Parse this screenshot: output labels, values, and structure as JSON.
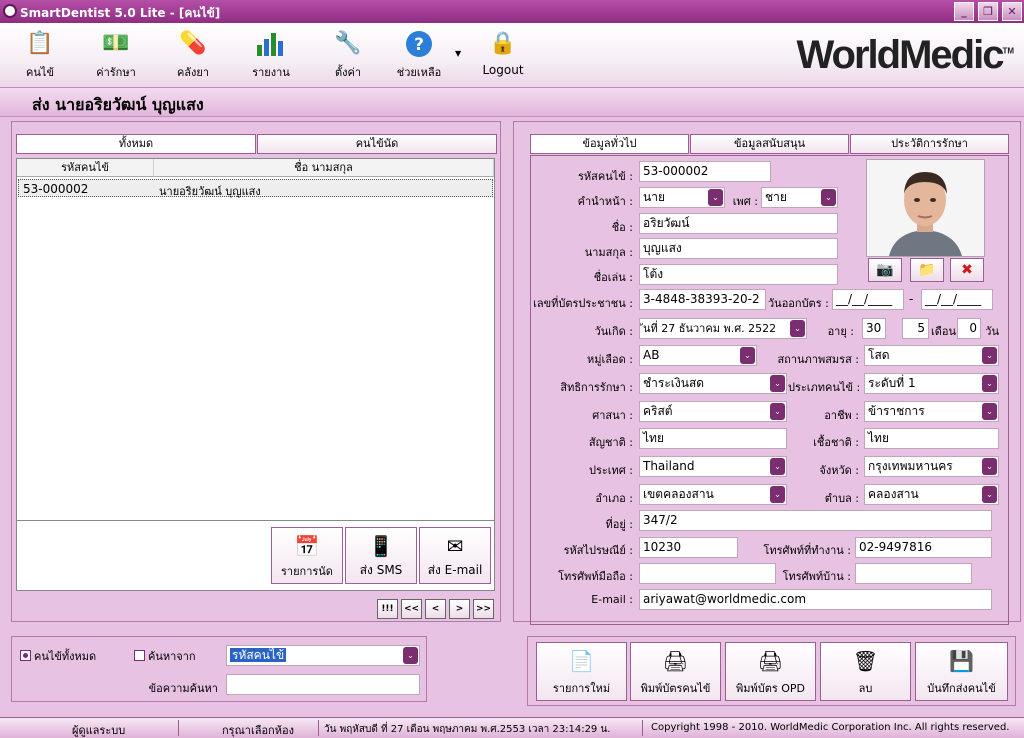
{
  "window": {
    "title": "SmartDentist 5.0 Lite - [คนไข้]"
  },
  "toolbar": {
    "items": [
      {
        "label": "คนไข้",
        "icon": "patient-icon"
      },
      {
        "label": "ค่ารักษา",
        "icon": "money-icon"
      },
      {
        "label": "คลังยา",
        "icon": "medicine-icon"
      },
      {
        "label": "รายงาน",
        "icon": "report-chart-icon"
      },
      {
        "label": "ตั้งค่า",
        "icon": "settings-tools-icon"
      },
      {
        "label": "ช่วยเหลือ",
        "icon": "help-icon"
      },
      {
        "label": "Logout",
        "icon": "lock-icon"
      }
    ],
    "brand": "WorldMedic",
    "brand_mark": "TM"
  },
  "patient_header": "ส่ง  นายอริยวัฒน์ บุญแสง",
  "left": {
    "tabs": [
      "ทั้งหมด",
      "คนไข้นัด"
    ],
    "columns": [
      "รหัสคนไข้",
      "ชื่อ นามสกุล"
    ],
    "rows": [
      {
        "id": "53-000002",
        "name": "นายอริยวัฒน์ บุญแสง"
      }
    ],
    "actions": {
      "appointments": "รายการนัด",
      "sms": "ส่ง SMS",
      "email": "ส่ง E-mail"
    },
    "nav": {
      "first": "!!!",
      "prev_page": "<<",
      "prev": "<",
      "next": ">",
      "next_page": ">>"
    },
    "search": {
      "radio_all": "คนไข้ทั้งหมด",
      "radio_search": "ค้นหาจาก",
      "search_by": "รหัสคนไข้",
      "keyword_label": "ข้อความค้นหา",
      "keyword": ""
    }
  },
  "right": {
    "tabs": [
      "ข้อมูลทั่วไป",
      "ข้อมูลสนับสนุน",
      "ประวัติการรักษา"
    ],
    "labels": {
      "patient_id": "รหัสคนไข้ :",
      "prefix": "คำนำหน้า :",
      "sex": "เพศ :",
      "first_name": "ชื่อ :",
      "last_name": "นามสกุล :",
      "nickname": "ชื่อเล่น :",
      "id_card": "เลขที่บัตรประชาชน :",
      "card_issue": "วันออกบัตร :",
      "birth": "วันเกิด :",
      "age": "อายุ :",
      "month": "เดือน",
      "day": "วัน",
      "blood": "หมู่เลือด :",
      "marital": "สถานภาพสมรส :",
      "right_to_treat": "สิทธิการรักษา :",
      "patient_type": "ประเภทคนไข้ :",
      "religion": "ศาสนา :",
      "career": "อาชีพ :",
      "nationality": "สัญชาติ :",
      "race": "เชื้อชาติ :",
      "country": "ประเทศ :",
      "province": "จังหวัด :",
      "district": "อำเภอ :",
      "subdistrict": "ตำบล :",
      "address": "ที่อยู่ :",
      "postcode": "รหัสไปรษณีย์ :",
      "work_phone": "โทรศัพท์ที่ทำงาน :",
      "mobile": "โทรศัพท์มือถือ :",
      "home_phone": "โทรศัพท์บ้าน :",
      "email": "E-mail :"
    },
    "values": {
      "patient_id": "53-000002",
      "prefix": "นาย",
      "sex": "ชาย",
      "first_name": "อริยวัฒน์",
      "last_name": "บุญแสง",
      "nickname": "โต้ง",
      "id_card": "3-4848-38393-20-2",
      "card_issue_from": "__/__/____",
      "card_issue_dash": "-",
      "card_issue_to": "__/__/____",
      "birth": "ันที่ 27  ธันวาคม  พ.ศ.  2522",
      "age_years": "30",
      "age_months": "5",
      "age_days": "0",
      "blood": "AB",
      "marital": "โสด",
      "right_to_treat": "ชำระเงินสด",
      "patient_type": "ระดับที่ 1",
      "religion": "คริสต์",
      "career": "ข้าราชการ",
      "nationality": "ไทย",
      "race": "ไทย",
      "country": "Thailand",
      "province": "กรุงเทพมหานคร",
      "district": "เขตคลองสาน",
      "subdistrict": "คลองสาน",
      "address": "347/2",
      "postcode": "10230",
      "work_phone": "02-9497816",
      "mobile": "",
      "home_phone": "",
      "email": "ariyawat@worldmedic.com"
    },
    "photo_buttons": {
      "camera": "camera-icon",
      "folder": "folder-icon",
      "delete": "delete-x-icon"
    },
    "bottom_buttons": [
      "รายการใหม่",
      "พิมพ์บัตรคนไข้",
      "พิมพ์บัตร OPD",
      "ลบ",
      "บันทึกส่งคนไข้"
    ]
  },
  "status": {
    "user": "ผู้ดูแลระบบ",
    "room": "กรุณาเลือกห้อง",
    "datetime": "วัน พฤหัสบดี ที่ 27 เดือน พฤษภาคม พ.ศ.2553 เวลา 23:14:29 น.",
    "copyright": "Copyright 1998 - 2010. WorldMedic Corporation Inc. All rights reserved."
  },
  "colors": {
    "title_bar": "#9e3a92",
    "accent": "#7a2e70",
    "background": "#e7c2e2"
  }
}
